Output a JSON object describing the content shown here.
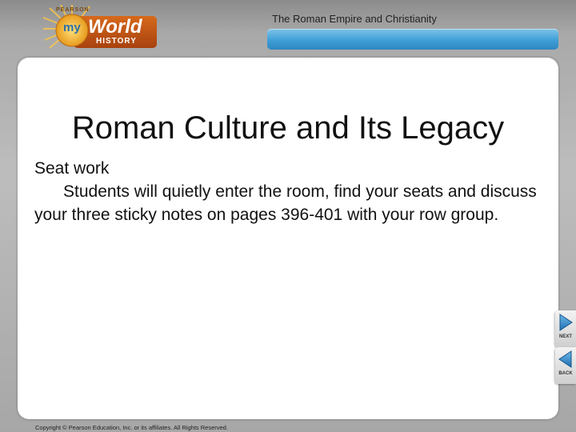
{
  "header": {
    "logo": {
      "brand": "PEARSON",
      "prefix": "my",
      "word": "World",
      "sub": "HISTORY"
    },
    "section_title": "The Roman Empire and Christianity",
    "accent_color": "#3f9fd6"
  },
  "slide": {
    "title": "Roman Culture and Its Legacy",
    "heading": "Seat work",
    "paragraph": "Students will quietly enter the room, find your seats and discuss your three sticky notes on pages 396-401 with your row group."
  },
  "nav": {
    "next_label": "NEXT",
    "back_label": "BACK",
    "next_icon": "play-right-icon",
    "back_icon": "play-left-icon"
  },
  "footer": {
    "copyright": "Copyright © Pearson Education, Inc. or its affiliates. All Rights Reserved."
  }
}
